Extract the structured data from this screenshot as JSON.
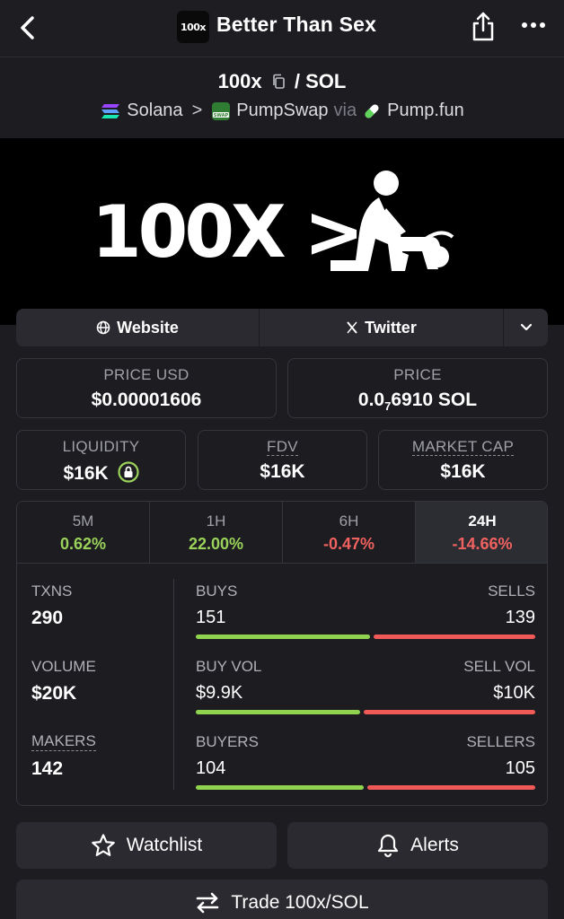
{
  "header": {
    "logo_text": "100x",
    "title": "Better Than Sex"
  },
  "pair": {
    "base": "100x",
    "quote": "/ SOL",
    "chain": "Solana",
    "dex": "PumpSwap",
    "via": "via",
    "launchpad": "Pump.fun"
  },
  "banner": {
    "text": "100X >"
  },
  "links": {
    "website": "Website",
    "twitter": "Twitter"
  },
  "price_usd": {
    "label": "PRICE USD",
    "value": "$0.00001606"
  },
  "price_native": {
    "label": "PRICE",
    "value_prefix": "0.0",
    "value_sub": "7",
    "value_suffix": "6910 SOL"
  },
  "liquidity": {
    "label": "LIQUIDITY",
    "value": "$16K"
  },
  "fdv": {
    "label": "FDV",
    "value": "$16K"
  },
  "market_cap": {
    "label": "MARKET CAP",
    "value": "$16K"
  },
  "timeframes": [
    {
      "label": "5M",
      "change": "0.62%"
    },
    {
      "label": "1H",
      "change": "22.00%"
    },
    {
      "label": "6H",
      "change": "-0.47%"
    },
    {
      "label": "24H",
      "change": "-14.66%"
    }
  ],
  "stats": {
    "txns": {
      "label": "TXNS",
      "value": "290"
    },
    "volume": {
      "label": "VOLUME",
      "value": "$20K"
    },
    "makers": {
      "label": "MAKERS",
      "value": "142"
    },
    "buys_sells": {
      "left_label": "BUYS",
      "right_label": "SELLS",
      "left_value": "151",
      "right_value": "139",
      "left_share": 0.52
    },
    "vol_split": {
      "left_label": "BUY VOL",
      "right_label": "SELL VOL",
      "left_value": "$9.9K",
      "right_value": "$10K",
      "left_share": 0.49
    },
    "buyers_sellers": {
      "left_label": "BUYERS",
      "right_label": "SELLERS",
      "left_value": "104",
      "right_value": "105",
      "left_share": 0.5
    }
  },
  "actions": {
    "watchlist": "Watchlist",
    "alerts": "Alerts",
    "trade": "Trade 100x/SOL"
  },
  "colors": {
    "positive": "#9bd35a",
    "negative": "#f0625f",
    "bar_buy": "#8fd34e",
    "bar_sell": "#ef5a58"
  }
}
